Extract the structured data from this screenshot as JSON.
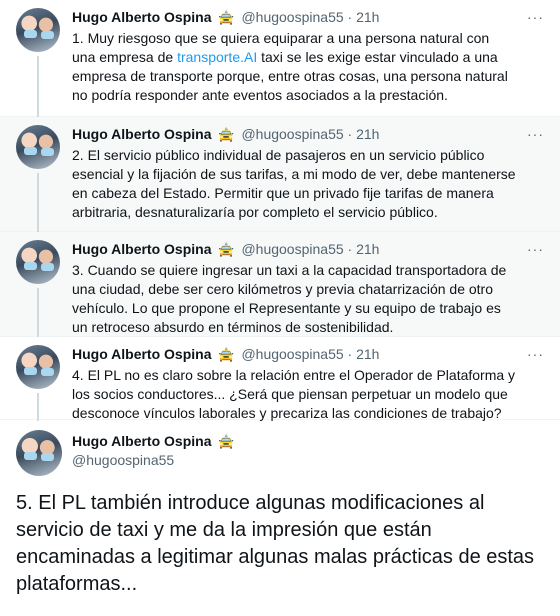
{
  "author": {
    "name": "Hugo Alberto Ospina",
    "badge": "🚖",
    "handle": "@hugoospina55"
  },
  "more_label": "···",
  "tweets": [
    {
      "time": "21h",
      "text_before": "1. Muy riesgoso que se quiera equiparar a una persona natural con una empresa de ",
      "link": "transporte.AI",
      "text_after": " taxi se les exige estar vinculado a una empresa de transporte porque, entre otras cosas, una persona natural no podría responder ante eventos asociados a la prestación."
    },
    {
      "time": "21h",
      "text": "2. El servicio público individual de pasajeros en un servicio público esencial y la fijación de sus tarifas, a mi modo de ver, debe mantenerse en cabeza del Estado. Permitir que un privado fije tarifas de manera arbitraria, desnaturalizaría por completo el servicio público."
    },
    {
      "time": "21h",
      "text": "3. Cuando se quiere ingresar un taxi a la capacidad transportadora de una ciudad, debe ser cero kilómetros y previa chatarrización de otro vehículo. Lo que propone el Representante y su equipo de trabajo es un retroceso absurdo en términos de sostenibilidad."
    },
    {
      "time": "21h",
      "text": "4. El PL no es claro sobre la relación entre el Operador de Plataforma y los socios conductores... ¿Será que piensan perpetuar un modelo que desconoce vínculos laborales y precariza las condiciones de trabajo?"
    }
  ],
  "main_tweet": {
    "text": "5. El PL también introduce algunas modificaciones al servicio de taxi y me da la impresión que están encaminadas a legitimar algunas malas prácticas de estas plataformas..."
  }
}
